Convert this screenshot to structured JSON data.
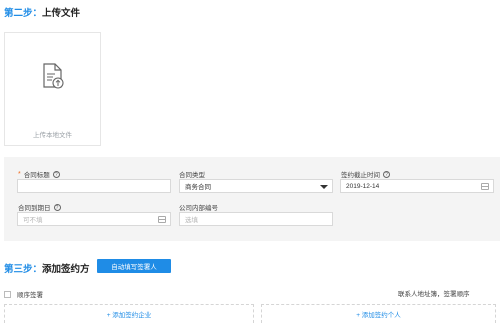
{
  "step2": {
    "num": "第二步：",
    "title": "上传文件"
  },
  "upload": {
    "label": "上传本地文件",
    "icon": "document-upload-icon"
  },
  "form": {
    "contract_title": {
      "label": "合同标题",
      "required_mark": "*",
      "value": ""
    },
    "contract_type": {
      "label": "合同类型",
      "value": "商务合同"
    },
    "sign_deadline": {
      "label": "签约截止时间",
      "value": "2019-12-14"
    },
    "expiry_date": {
      "label": "合同到期日",
      "placeholder": "可不填"
    },
    "internal_no": {
      "label": "公司内部编号",
      "placeholder": "选填"
    }
  },
  "step3": {
    "num": "第三步：",
    "title": "添加签约方",
    "auto_fill_button": "自动填写签署人"
  },
  "signing_order": {
    "label": "顺序签署"
  },
  "right_note": "联系人地址簿，签署顺序",
  "parties": {
    "add_company": "+ 添加签约企业",
    "add_person": "+ 添加签约个人"
  },
  "colors": {
    "accent": "#1f8ce6",
    "required": "#f26b1d",
    "panel_bg": "#f4f4f4"
  }
}
